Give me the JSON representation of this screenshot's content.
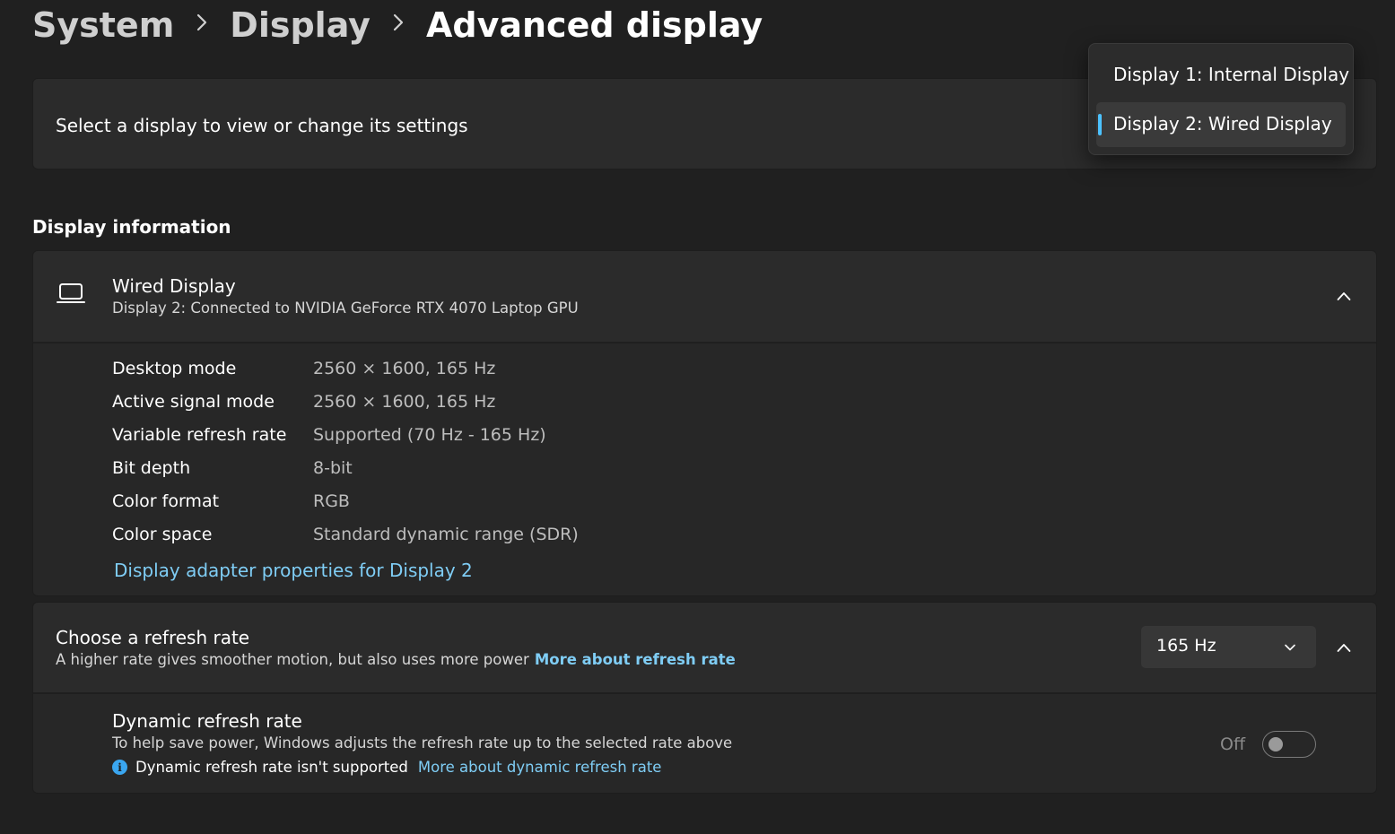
{
  "breadcrumb": {
    "items": [
      "System",
      "Display",
      "Advanced display"
    ]
  },
  "display_select": {
    "label": "Select a display to view or change its settings",
    "options": [
      "Display 1: Internal Display",
      "Display 2: Wired Display"
    ],
    "selected": "Display 2: Wired Display"
  },
  "display_info": {
    "section_title": "Display information",
    "name": "Wired Display",
    "subtitle": "Display 2: Connected to NVIDIA GeForce RTX 4070 Laptop GPU",
    "rows": [
      {
        "label": "Desktop mode",
        "value": "2560 × 1600, 165 Hz"
      },
      {
        "label": "Active signal mode",
        "value": "2560 × 1600, 165 Hz"
      },
      {
        "label": "Variable refresh rate",
        "value": "Supported (70 Hz - 165 Hz)"
      },
      {
        "label": "Bit depth",
        "value": "8-bit"
      },
      {
        "label": "Color format",
        "value": "RGB"
      },
      {
        "label": "Color space",
        "value": "Standard dynamic range (SDR)"
      }
    ],
    "adapter_link": "Display adapter properties for Display 2"
  },
  "refresh_rate": {
    "title": "Choose a refresh rate",
    "subtitle": "A higher rate gives smoother motion, but also uses more power",
    "link": "More about refresh rate",
    "selected": "165 Hz"
  },
  "dynamic_refresh": {
    "title": "Dynamic refresh rate",
    "subtitle": "To help save power, Windows adjusts the refresh rate up to the selected rate above",
    "note": "Dynamic refresh rate isn't supported",
    "link": "More about dynamic refresh rate",
    "toggle_label": "Off",
    "toggle_on": false
  },
  "icons": {
    "display": "laptop-icon",
    "collapse": "chevron-up-icon",
    "dropdown": "chevron-down-icon",
    "breadcrumb_separator": "chevron-right-icon",
    "info": "info-icon"
  },
  "colors": {
    "background": "#202020",
    "card": "#2b2b2b",
    "link": "#7fcdf5",
    "accent": "#4cc2ff"
  }
}
